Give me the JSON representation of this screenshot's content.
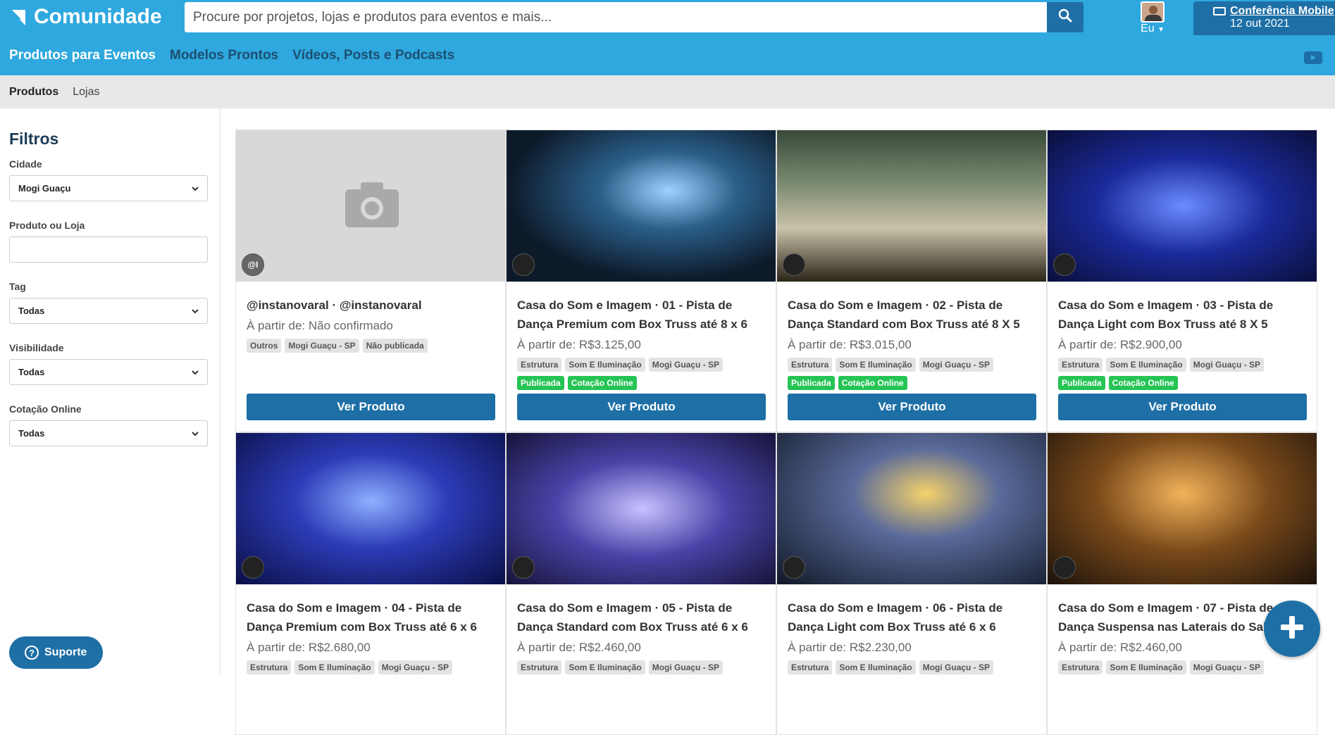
{
  "header": {
    "logo_text": "Comunidade",
    "search_placeholder": "Procure por projetos, lojas e produtos para eventos e mais...",
    "user_label": "Eu",
    "event_title": "Conferência Mobile",
    "event_date": "12 out 2021"
  },
  "nav": {
    "items": [
      "Produtos para Eventos",
      "Modelos Prontos",
      "Vídeos, Posts e Podcasts"
    ]
  },
  "subnav": {
    "items": [
      "Produtos",
      "Lojas"
    ]
  },
  "sidebar": {
    "title": "Filtros",
    "city_label": "Cidade",
    "city_value": "Mogi Guaçu",
    "search_label": "Produto ou Loja",
    "search_value": "",
    "tag_label": "Tag",
    "tag_value": "Todas",
    "visibility_label": "Visibilidade",
    "visibility_value": "Todas",
    "quote_label": "Cotação Online",
    "quote_value": "Todas",
    "support_label": "Suporte"
  },
  "products": [
    {
      "title": "@instanovaral · @instanovaral",
      "price": "À partir de: Não confirmado",
      "tags": [
        "Outros",
        "Mogi Guaçu - SP",
        "Não publicada"
      ],
      "green_tags": [],
      "badge": "@I",
      "button": "Ver Produto"
    },
    {
      "title": "Casa do Som e Imagem · 01 - Pista de Dança Premium com Box Truss até 8 x 6",
      "price": "À partir de: R$3.125,00",
      "tags": [
        "Estrutura",
        "Som E Iluminação",
        "Mogi Guaçu - SP"
      ],
      "green_tags": [
        "Publicada",
        "Cotação Online"
      ],
      "badge": "",
      "button": "Ver Produto"
    },
    {
      "title": "Casa do Som e Imagem · 02 - Pista de Dança Standard com Box Truss até 8 X 5",
      "price": "À partir de: R$3.015,00",
      "tags": [
        "Estrutura",
        "Som E Iluminação",
        "Mogi Guaçu - SP"
      ],
      "green_tags": [
        "Publicada",
        "Cotação Online"
      ],
      "badge": "",
      "button": "Ver Produto"
    },
    {
      "title": "Casa do Som e Imagem · 03 - Pista de Dança Light com Box Truss até 8 X 5",
      "price": "À partir de: R$2.900,00",
      "tags": [
        "Estrutura",
        "Som E Iluminação",
        "Mogi Guaçu - SP"
      ],
      "green_tags": [
        "Publicada",
        "Cotação Online"
      ],
      "badge": "",
      "button": "Ver Produto"
    },
    {
      "title": "Casa do Som e Imagem · 04 - Pista de Dança Premium com Box Truss até 6 x 6",
      "price": "À partir de: R$2.680,00",
      "tags": [
        "Estrutura",
        "Som E Iluminação",
        "Mogi Guaçu - SP"
      ],
      "green_tags": [],
      "badge": "",
      "button": "Ver Produto"
    },
    {
      "title": "Casa do Som e Imagem · 05 - Pista de Dança Standard com Box Truss até 6 x 6",
      "price": "À partir de: R$2.460,00",
      "tags": [
        "Estrutura",
        "Som E Iluminação",
        "Mogi Guaçu - SP"
      ],
      "green_tags": [],
      "badge": "",
      "button": "Ver Produto"
    },
    {
      "title": "Casa do Som e Imagem · 06 - Pista de Dança Light com Box Truss até 6 x 6",
      "price": "À partir de: R$2.230,00",
      "tags": [
        "Estrutura",
        "Som E Iluminação",
        "Mogi Guaçu - SP"
      ],
      "green_tags": [],
      "badge": "",
      "button": "Ver Produto"
    },
    {
      "title": "Casa do Som e Imagem · 07 - Pista de Dança Suspensa nas Laterais do Salão",
      "price": "À partir de: R$2.460,00",
      "tags": [
        "Estrutura",
        "Som E Iluminação",
        "Mogi Guaçu - SP"
      ],
      "green_tags": [],
      "badge": "",
      "button": "Ver Produto"
    }
  ],
  "colors": {
    "header_blue": "#2ea8de",
    "button_blue": "#1e6fa6",
    "published_green": "#25c454"
  }
}
